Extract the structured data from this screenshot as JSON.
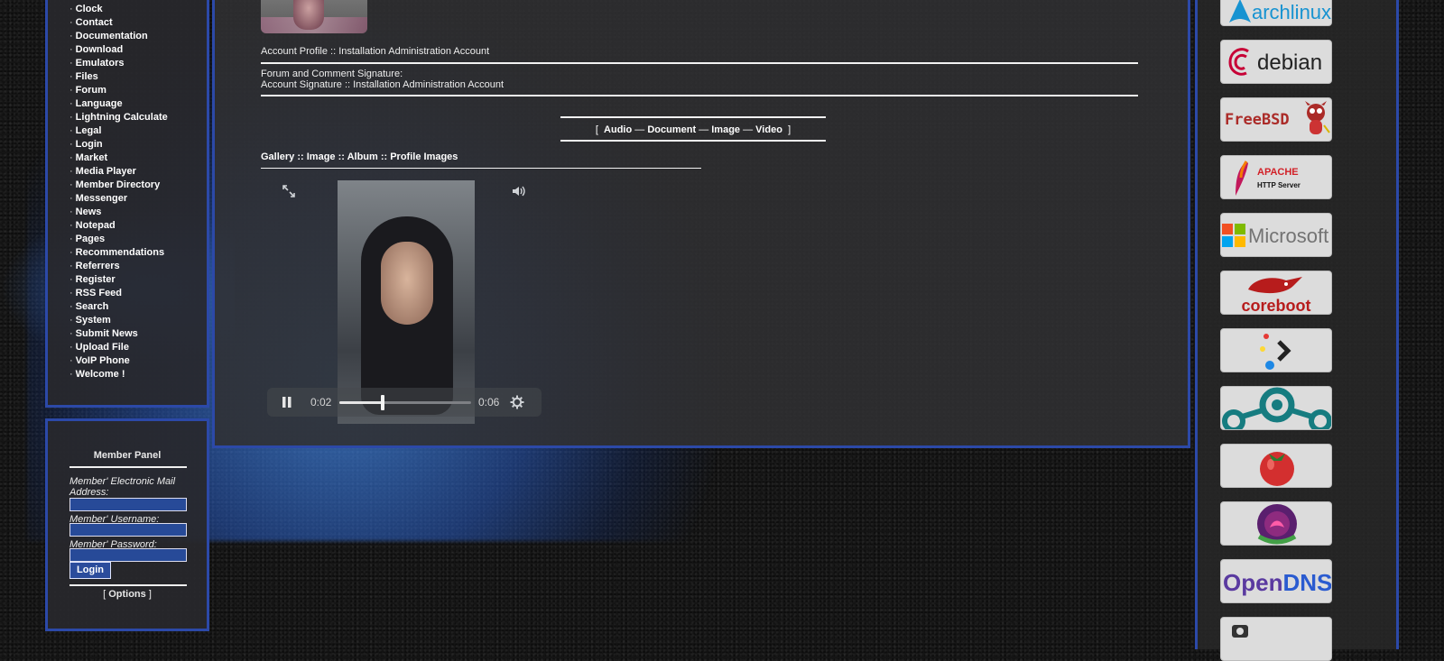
{
  "left_menu": {
    "items": [
      "Clock",
      "Contact",
      "Documentation",
      "Download",
      "Emulators",
      "Files",
      "Forum",
      "Language",
      "Lightning Calculate",
      "Legal",
      "Login",
      "Market",
      "Media Player",
      "Member Directory",
      "Messenger",
      "News",
      "Notepad",
      "Pages",
      "Recommendations",
      "Referrers",
      "Register",
      "RSS Feed",
      "Search",
      "System",
      "Submit News",
      "Upload File",
      "VoIP Phone",
      "Welcome !"
    ],
    "bullet": "·"
  },
  "member_panel": {
    "title": "Member Panel",
    "email_label": "Member' Electronic Mail Address:",
    "username_label": "Member' Username:",
    "password_label": "Member' Password:",
    "login_button": "Login",
    "options_open": "[",
    "options_link": "Options",
    "options_close": "]"
  },
  "main": {
    "account_profile": "Account Profile :: Installation Administration Account",
    "signature_heading": "Forum and Comment Signature:",
    "signature_text": "Account Signature :: Installation Administration Account",
    "media_nav": {
      "open": "[",
      "audio": "Audio",
      "sep": "—",
      "document": "Document",
      "image": "Image",
      "video": "Video",
      "close": "]"
    },
    "gallery_crumb": "Gallery :: Image :: Album :: Profile Images"
  },
  "player": {
    "current_time": "0:02",
    "duration": "0:06",
    "progress_fraction": 0.33,
    "expand_icon": "expand-icon",
    "volume_icon": "volume-icon",
    "pause_icon": "pause-icon",
    "settings_icon": "gear-icon"
  },
  "badges": {
    "archlinux": "archlinux",
    "debian": "debian",
    "freebsd": "FreeBSD",
    "apache_top": "APACHE",
    "apache_bottom": "HTTP Server",
    "microsoft": "Microsoft",
    "coreboot": "coreboot",
    "opendns_a": "Open",
    "opendns_b": "DNS"
  },
  "colors": {
    "panel_border": "#2c49a8",
    "input_bg": "#274a98",
    "debian_red": "#c70036",
    "freebsd_red": "#ab2b28",
    "apache_orange": "#d22128",
    "opendns_purple": "#5a3aa0",
    "opendns_blue": "#2a5bd0"
  }
}
